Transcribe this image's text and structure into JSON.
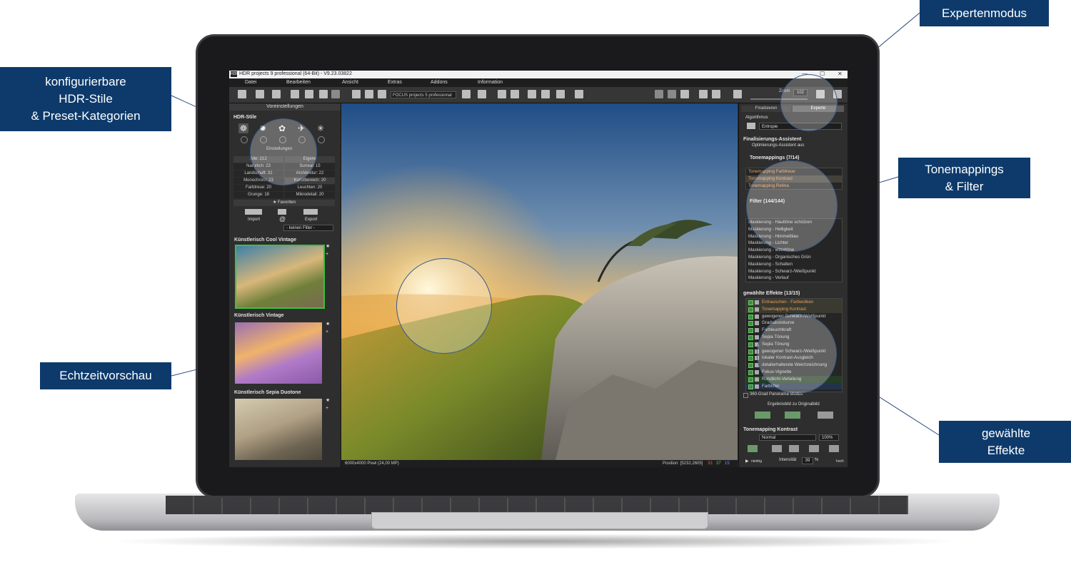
{
  "callouts": {
    "hdr_styles": [
      "konfigurierbare",
      "HDR-Stile",
      "& Preset-Kategorien"
    ],
    "expert_mode": "Expertenmodus",
    "tonemappings": [
      "Tonemappings",
      "& Filter"
    ],
    "realtime_preview": "Echtzeitvorschau",
    "selected_effects": [
      "gewählte",
      "Effekte"
    ]
  },
  "app": {
    "title": "HDR projects 9 professional (64-Bit) - V9.23.03822",
    "logo": "HDR",
    "window_controls": [
      "—",
      "☐",
      "✕"
    ],
    "menu": [
      "Datei",
      "Bearbeiten",
      "Ansicht",
      "Extras",
      "Addons",
      "Information"
    ],
    "toolbar": {
      "focus_select": "FOCUS projects 5 professional",
      "zoom_label": "Zoom",
      "zoom_value": "102"
    },
    "left_panel": {
      "header": "Voreinstellungen",
      "hdr_styles_title": "HDR-Stile",
      "style_icons": [
        "style-icon-1",
        "style-icon-2",
        "style-icon-3",
        "style-icon-4",
        "style-icon-5"
      ],
      "settings_label": "Einstellungen",
      "categories": [
        [
          "Alle: 212",
          "Eigene"
        ],
        [
          "Natürlich: 23",
          "Surreal: 15"
        ],
        [
          "Landschaft: 31",
          "Architektur: 22"
        ],
        [
          "Monochrom: 23",
          "Kunstbereich: 20"
        ],
        [
          "Farbtreue: 20",
          "Leuchten: 20"
        ],
        [
          "Grunge: 18",
          "Mikrodetail: 20"
        ]
      ],
      "favorites_label": "Favoriten",
      "import_label": "Import",
      "export_label": "Export",
      "filter_select": "- keinen Filter -",
      "presets": [
        "Künstlerisch Cool Vintage",
        "Künstlerisch Vintage",
        "Künstlerisch Sepia Duotone"
      ]
    },
    "status": {
      "dimensions": "6000x4000 Pixel (24,00 MP)",
      "position": "Position: [5232,2605]",
      "rgb": [
        "33",
        "37",
        "15"
      ]
    },
    "right_panel": {
      "tabs": [
        "Finalisieren",
        "Experte"
      ],
      "algorithm_label": "Algorithmus",
      "algorithm_value": "Entropie",
      "assistant_title": "Finalisierungs-Assistent",
      "assistant_option": "Optimierungs-Assistent aus",
      "tonemapping_header": "Tonemappings (7/14)",
      "tonemappings": [
        "Tonemapping Farbtreue",
        "Tonemapping Kontrast",
        "Tonemapping Retina"
      ],
      "filter_header": "Filter (144/144)",
      "filters": [
        "Maskierung - Hauttöne schützen",
        "Maskierung - Helligkeit",
        "Maskierung - Himmelblau",
        "Maskierung - Lichter",
        "Maskierung - Mitteltöne",
        "Maskierung - Organisches Grün",
        "Maskierung - Schatten",
        "Maskierung - Schwarz-/Weißpunkt",
        "Maskierung - Verlauf"
      ],
      "effects_header": "gewählte Effekte (13/15)",
      "effects": [
        "Entrauschen - Farbwolken",
        "Tonemapping Kontrast",
        "gewogener Schwarz-/Weißpunkt",
        "Gradationskurve",
        "Farbleuchtkraft",
        "Sepia Tönung",
        "Sepia Tönung",
        "gewogener Schwarz-/Weißpunkt",
        "lokaler Kontrast-Ausgleich",
        "detailerhaltende Weichzeichnung",
        "Fokus-Vignette",
        "Randlicht-Verteilung",
        "Farbfilter"
      ],
      "panorama_label": "360-Grad Panorama Modus",
      "original_label": "Ergebnisbild zu Originalbild",
      "bottom_title": "Tonemapping Kontrast",
      "blend_mode": "Normal",
      "opacity": "100%",
      "intensity_label": "Intensität",
      "intensity_value": "39",
      "intensity_unit": "%",
      "left_end": "niedrig",
      "right_end": "hoch"
    }
  }
}
